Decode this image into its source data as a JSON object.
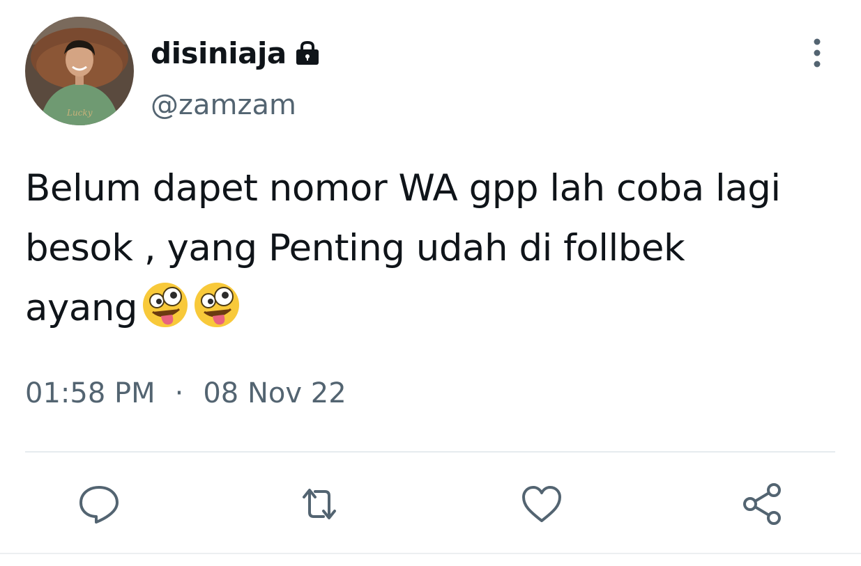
{
  "author": {
    "display_name": "disiniaja",
    "handle": "@zamzam",
    "protected": true,
    "avatar_icon": "user-avatar-photo",
    "lock_icon": "lock-icon"
  },
  "tweet": {
    "text_lines": [
      "Belum dapet nomor WA gpp lah coba lagi",
      "besok , yang Penting udah di follbek",
      "ayang"
    ],
    "emojis": [
      "zany-face",
      "zany-face"
    ],
    "time": "01:58 PM",
    "separator": "·",
    "date": "08 Nov 22"
  },
  "actions": [
    {
      "name": "reply",
      "icon": "reply-icon"
    },
    {
      "name": "retweet",
      "icon": "retweet-icon"
    },
    {
      "name": "like",
      "icon": "heart-icon"
    },
    {
      "name": "share",
      "icon": "share-icon"
    }
  ],
  "colors": {
    "text_primary": "#0f1419",
    "text_secondary": "#536471",
    "divider": "#e6ebef",
    "background": "#ffffff"
  }
}
